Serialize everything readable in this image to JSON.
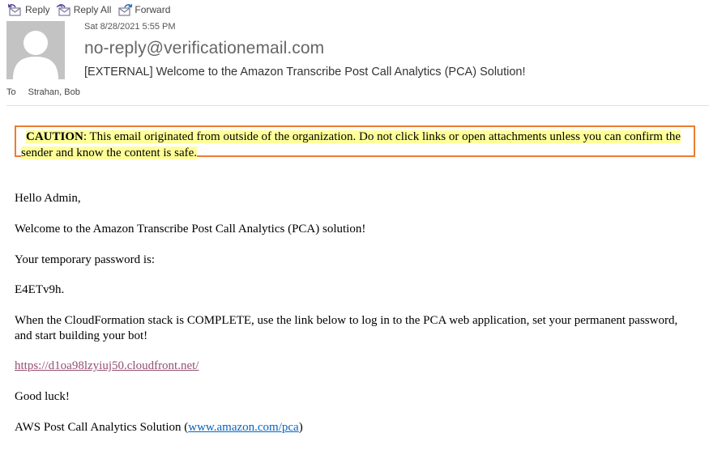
{
  "toolbar": {
    "reply": "Reply",
    "reply_all": "Reply All",
    "forward": "Forward"
  },
  "header": {
    "date": "Sat 8/28/2021 5:55 PM",
    "from": "no-reply@verificationemail.com",
    "subject": "[EXTERNAL] Welcome to the Amazon Transcribe Post Call Analytics (PCA) Solution!",
    "to_label": "To",
    "to_name": "Strahan, Bob"
  },
  "caution": {
    "label": "CAUTION",
    "text": ": This email originated from outside of the organization. Do not click links or open attachments unless you can confirm the sender and know the content is safe."
  },
  "body": {
    "greeting": "Hello Admin,",
    "welcome": "Welcome to the Amazon Transcribe Post Call Analytics (PCA) solution!",
    "temp_password_label": "Your temporary password is:",
    "temp_password": "E4ETv9h.",
    "instructions": "When the CloudFormation stack is COMPLETE, use the link below to log in to the PCA web application, set your permanent password, and start building your bot!",
    "app_link": "https://d1oa98lzyiuj50.cloudfront.net/",
    "good_luck": "Good luck!",
    "signature_prefix": "AWS Post Call Analytics Solution (",
    "signature_link": "www.amazon.com/pca",
    "signature_suffix": ")"
  },
  "colors": {
    "caution_border": "#ed7d31",
    "caution_highlight": "#ffff99",
    "visited_link": "#954f72",
    "link": "#0563c1",
    "avatar_bg": "#c3c3c3"
  }
}
